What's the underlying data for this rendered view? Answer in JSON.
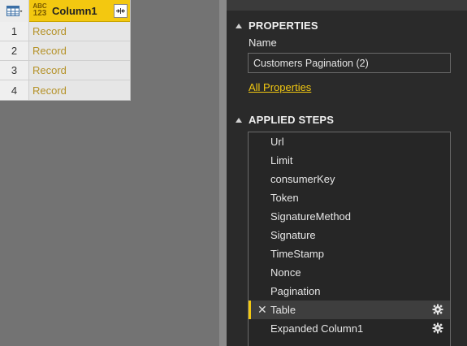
{
  "grid": {
    "column_type_icon": {
      "top": "ABC",
      "bottom": "123"
    },
    "column_name": "Column1",
    "rows": [
      {
        "num": "1",
        "value": "Record"
      },
      {
        "num": "2",
        "value": "Record"
      },
      {
        "num": "3",
        "value": "Record"
      },
      {
        "num": "4",
        "value": "Record"
      }
    ]
  },
  "properties": {
    "section_title": "PROPERTIES",
    "name_label": "Name",
    "name_value": "Customers Pagination (2)",
    "all_properties_link": "All Properties"
  },
  "applied_steps": {
    "section_title": "APPLIED STEPS",
    "steps": [
      {
        "label": "Url",
        "selected": false,
        "gear": false
      },
      {
        "label": "Limit",
        "selected": false,
        "gear": false
      },
      {
        "label": "consumerKey",
        "selected": false,
        "gear": false
      },
      {
        "label": "Token",
        "selected": false,
        "gear": false
      },
      {
        "label": "SignatureMethod",
        "selected": false,
        "gear": false
      },
      {
        "label": "Signature",
        "selected": false,
        "gear": false
      },
      {
        "label": "TimeStamp",
        "selected": false,
        "gear": false
      },
      {
        "label": "Nonce",
        "selected": false,
        "gear": false
      },
      {
        "label": "Pagination",
        "selected": false,
        "gear": false
      },
      {
        "label": "Table",
        "selected": true,
        "gear": true
      },
      {
        "label": "Expanded Column1",
        "selected": false,
        "gear": true
      }
    ]
  },
  "colors": {
    "accent": "#f2c811",
    "panel_bg": "#2a2a2a",
    "record_text": "#b59228"
  },
  "icons": {
    "table_icon": "table-icon",
    "expand_icon": "expand-column-icon",
    "delete_step_icon": "close-icon",
    "step_settings_icon": "gear-icon",
    "collapse_icon": "triangle-collapse-icon"
  }
}
